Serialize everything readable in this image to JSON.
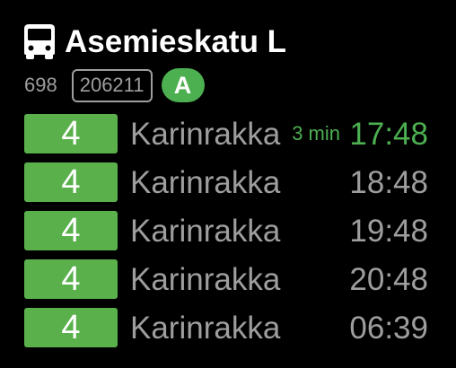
{
  "stop": {
    "icon": "bus-icon",
    "name": "Asemieskatu L",
    "number": "698",
    "code": "206211",
    "zone": "A"
  },
  "colors": {
    "background": "#000000",
    "route_badge": "#5ab14c",
    "accent_green": "#4caf50",
    "muted_text": "#9e9e9e",
    "title_text": "#ffffff"
  },
  "departures": [
    {
      "route": "4",
      "destination": "Karinrakka",
      "countdown": "3 min",
      "time": "17:48",
      "highlight": true
    },
    {
      "route": "4",
      "destination": "Karinrakka",
      "countdown": "",
      "time": "18:48",
      "highlight": false
    },
    {
      "route": "4",
      "destination": "Karinrakka",
      "countdown": "",
      "time": "19:48",
      "highlight": false
    },
    {
      "route": "4",
      "destination": "Karinrakka",
      "countdown": "",
      "time": "20:48",
      "highlight": false
    },
    {
      "route": "4",
      "destination": "Karinrakka",
      "countdown": "",
      "time": "06:39",
      "highlight": false
    }
  ]
}
